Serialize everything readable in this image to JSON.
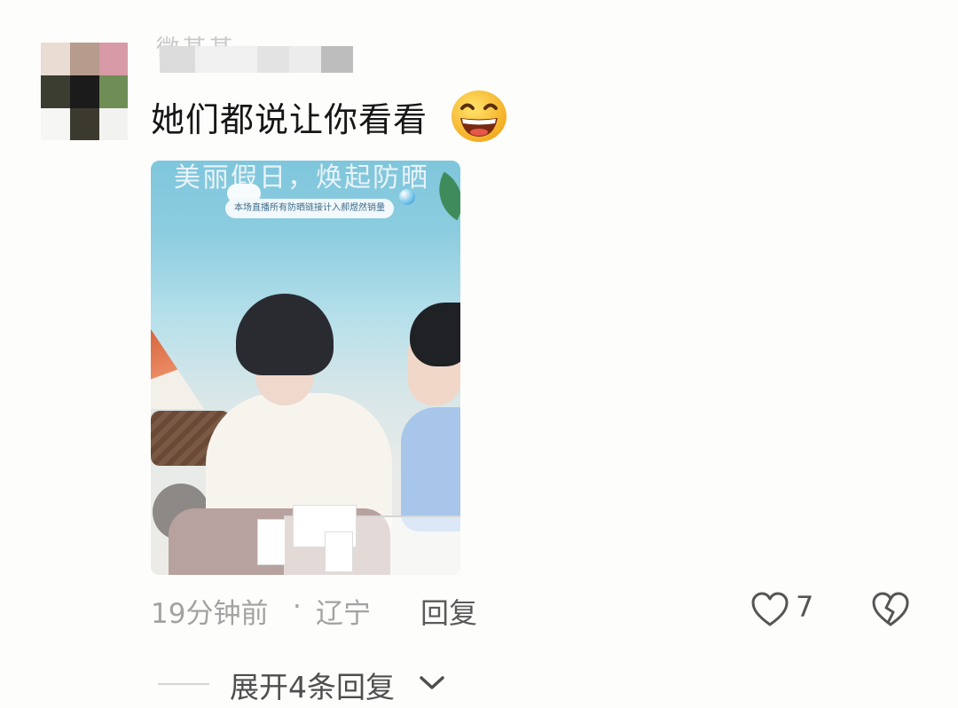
{
  "comment": {
    "author_name": "微某某",
    "text": "她们都说让你看看",
    "emoji": "grinning-face-emoji",
    "image": {
      "banner_title": "美丽假日，焕起防晒",
      "banner_subtitle": "本场直播所有防晒链接计入郝煜然销量"
    },
    "time": "19分钟前",
    "separator": "·",
    "location": "辽宁",
    "reply_label": "回复",
    "like_count": "7",
    "expand_replies_label": "展开4条回复"
  },
  "icons": {
    "like": "heart-outline-icon",
    "dislike": "broken-heart-icon",
    "expand": "chevron-down-icon"
  },
  "colors": {
    "background": "#fdfdfb",
    "primary_text": "#161616",
    "meta_text": "#a2a2a2"
  }
}
